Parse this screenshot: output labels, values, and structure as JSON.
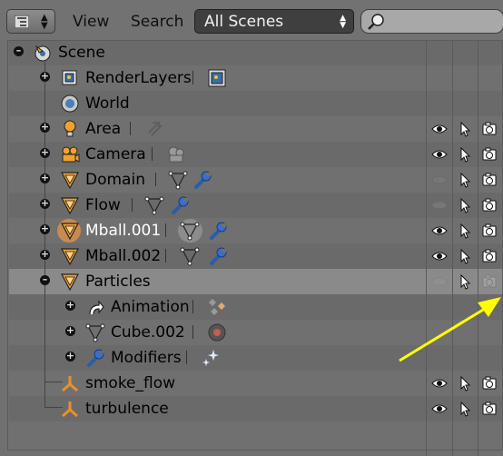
{
  "header": {
    "view_label": "View",
    "search_label": "Search",
    "display_mode": "All Scenes",
    "search_placeholder": ""
  },
  "tree": [
    {
      "label": "Scene",
      "icon": "scene-icon",
      "expanded": true
    },
    {
      "label": "RenderLayers",
      "icon": "renderlayers-icon",
      "sub": [
        "renderlayer-icon"
      ]
    },
    {
      "label": "World",
      "icon": "world-icon"
    },
    {
      "label": "Area",
      "icon": "lamp-icon",
      "sub": [
        "lamp-data-icon"
      ],
      "visible": true,
      "selectable": true,
      "renderable": true
    },
    {
      "label": "Camera",
      "icon": "camera-icon",
      "sub": [
        "camera-data-icon"
      ],
      "visible": true,
      "selectable": true,
      "renderable": true
    },
    {
      "label": "Domain",
      "icon": "mesh-object-icon",
      "sub": [
        "mesh-data-icon",
        "modifier-wrench-icon"
      ],
      "visible": false,
      "selectable": true,
      "renderable": true
    },
    {
      "label": "Flow",
      "icon": "mesh-object-icon",
      "sub": [
        "mesh-data-icon",
        "modifier-wrench-icon"
      ],
      "visible": false,
      "selectable": true,
      "renderable": true
    },
    {
      "label": "Mball.001",
      "icon": "mesh-object-icon",
      "sub": [
        "mesh-data-icon",
        "modifier-wrench-icon"
      ],
      "visible": true,
      "selectable": true,
      "renderable": true,
      "active": true
    },
    {
      "label": "Mball.002",
      "icon": "mesh-object-icon",
      "sub": [
        "mesh-data-icon",
        "modifier-wrench-icon"
      ],
      "visible": true,
      "selectable": true,
      "renderable": true
    },
    {
      "label": "Particles",
      "icon": "mesh-object-icon",
      "expanded": true,
      "highlighted": true,
      "visible": false,
      "selectable": true,
      "renderable": false
    },
    {
      "label": "Animation",
      "icon": "animation-icon",
      "sub": [
        "action-keyframes-icon"
      ]
    },
    {
      "label": "Cube.002",
      "icon": "mesh-data-icon",
      "sub": [
        "material-sphere-icon"
      ]
    },
    {
      "label": "Modifiers",
      "icon": "modifier-wrench-icon",
      "sub": [
        "particles-sparkle-icon"
      ]
    },
    {
      "label": "smoke_flow",
      "icon": "force-field-icon",
      "visible": true,
      "selectable": true,
      "renderable": true
    },
    {
      "label": "turbulence",
      "icon": "force-field-icon",
      "visible": true,
      "selectable": true,
      "renderable": true
    }
  ],
  "colors": {
    "background": "#727272",
    "annotation_arrow": "#ffff00",
    "object_orange": "#e8902a",
    "highlight_row": "#8a8a8a"
  }
}
